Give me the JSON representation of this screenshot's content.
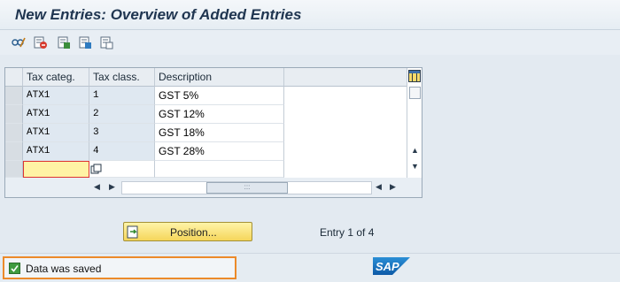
{
  "title": "New Entries: Overview of Added Entries",
  "toolbar": {
    "icons": [
      "glasses-edit-icon",
      "delete-row-icon",
      "select-all-icon",
      "select-block-icon",
      "deselect-icon"
    ]
  },
  "table": {
    "columns": [
      "Tax categ.",
      "Tax class.",
      "Description"
    ],
    "rows": [
      {
        "cat": "ATX1",
        "cls": "1",
        "desc": "GST 5%"
      },
      {
        "cat": "ATX1",
        "cls": "2",
        "desc": "GST 12%"
      },
      {
        "cat": "ATX1",
        "cls": "3",
        "desc": "GST 18%"
      },
      {
        "cat": "ATX1",
        "cls": "4",
        "desc": "GST 28%"
      }
    ]
  },
  "position_button": "Position...",
  "entry_info": "Entry 1 of 4",
  "status": {
    "message": "Data was saved"
  },
  "logo_text": "SAP",
  "colors": {
    "highlight": "#ec8a2a",
    "input_focus": "#fff3a5",
    "button": "#f5d65b"
  }
}
